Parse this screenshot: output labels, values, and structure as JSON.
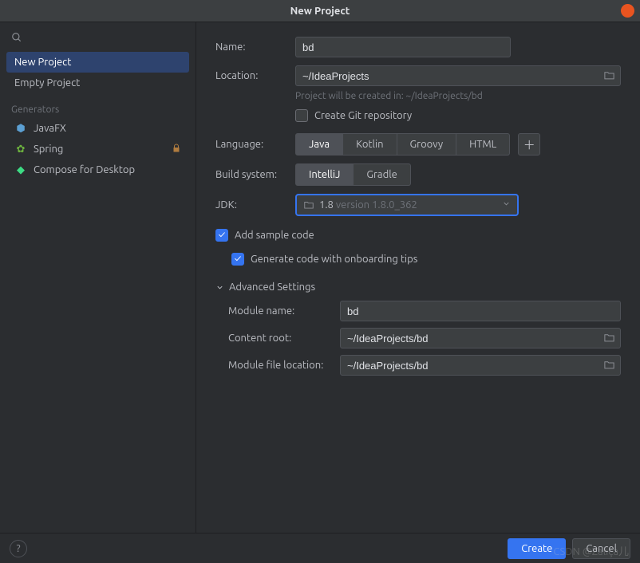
{
  "window": {
    "title": "New Project"
  },
  "sidebar": {
    "items": [
      {
        "label": "New Project",
        "selected": true
      },
      {
        "label": "Empty Project",
        "selected": false
      }
    ],
    "generators_header": "Generators",
    "generators": [
      {
        "label": "JavaFX",
        "icon": "javafx",
        "color": "#5ca0d3"
      },
      {
        "label": "Spring",
        "icon": "spring",
        "color": "#6db33f",
        "locked": true
      },
      {
        "label": "Compose for Desktop",
        "icon": "compose",
        "color": "#3ddc84"
      }
    ]
  },
  "form": {
    "name_label": "Name:",
    "name_value": "bd",
    "location_label": "Location:",
    "location_value": "~/IdeaProjects",
    "location_hint": "Project will be created in: ~/IdeaProjects/bd",
    "create_git_label": "Create Git repository",
    "create_git_checked": false,
    "language_label": "Language:",
    "language_options": [
      "Java",
      "Kotlin",
      "Groovy",
      "HTML"
    ],
    "language_selected": "Java",
    "build_label": "Build system:",
    "build_options": [
      "IntelliJ",
      "Gradle"
    ],
    "build_selected": "IntelliJ",
    "jdk_label": "JDK:",
    "jdk_value_main": "1.8",
    "jdk_value_dim": " version 1.8.0_362",
    "sample_label": "Add sample code",
    "sample_checked": true,
    "onboarding_label": "Generate code with onboarding tips",
    "onboarding_checked": true,
    "advanced_header": "Advanced Settings",
    "module_name_label": "Module name:",
    "module_name_value": "bd",
    "content_root_label": "Content root:",
    "content_root_value": "~/IdeaProjects/bd",
    "module_file_label": "Module file location:",
    "module_file_value": "~/IdeaProjects/bd"
  },
  "footer": {
    "create_label": "Create",
    "cancel_label": "Cancel"
  },
  "watermark": "CSDN @Zaliça儿"
}
